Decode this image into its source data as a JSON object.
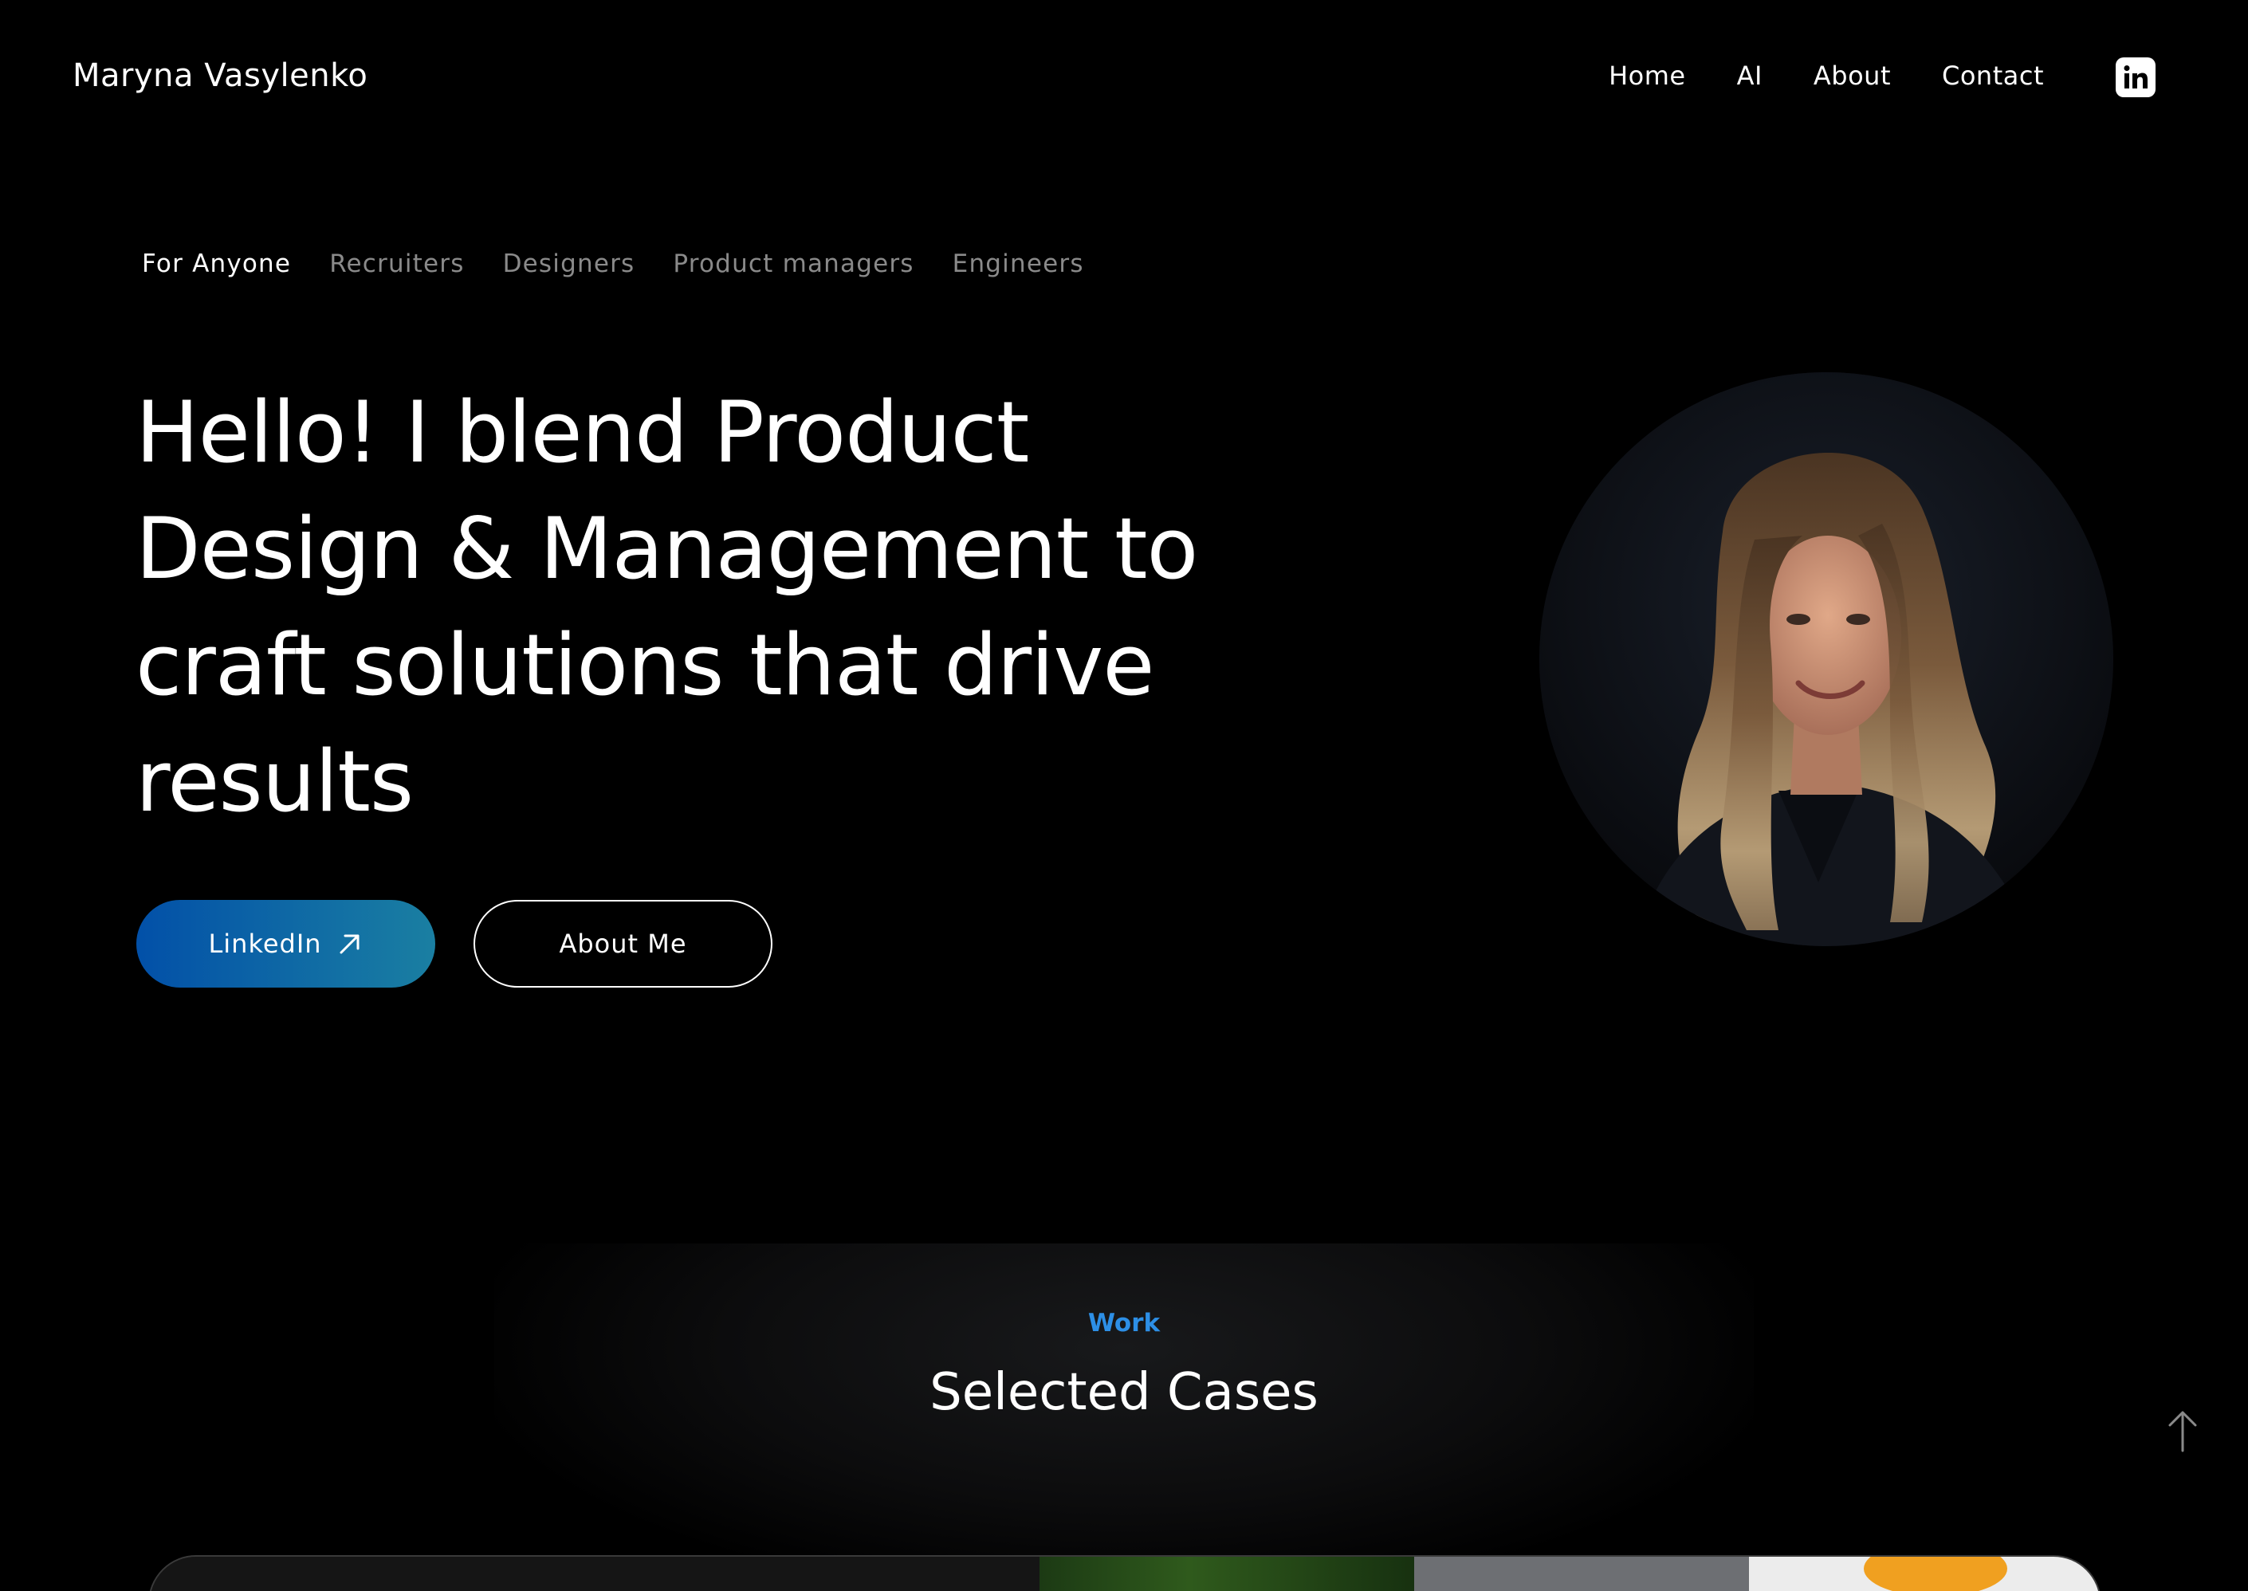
{
  "header": {
    "brand": "Maryna Vasylenko",
    "nav": [
      "Home",
      "AI",
      "About",
      "Contact"
    ]
  },
  "tabs": {
    "items": [
      "For Anyone",
      "Recruiters",
      "Designers",
      "Product managers",
      "Engineers"
    ],
    "active": "For Anyone"
  },
  "hero": {
    "headline_lines": [
      "Hello! I blend Product",
      "Design & Management to",
      "craft solutions that drive",
      "results"
    ],
    "linkedin_label": "LinkedIn",
    "about_label": "About Me"
  },
  "work": {
    "eyebrow": "Work",
    "title": "Selected Cases"
  },
  "colors": {
    "background": "#000000",
    "accent_blue": "#2d8fe6",
    "button_gradient_start": "#0250a8",
    "button_gradient_end": "#1a7fa2"
  },
  "icons": {
    "header_social": "linkedin-icon",
    "button_arrow": "arrow-up-right-icon",
    "scroll": "arrow-up-icon"
  }
}
